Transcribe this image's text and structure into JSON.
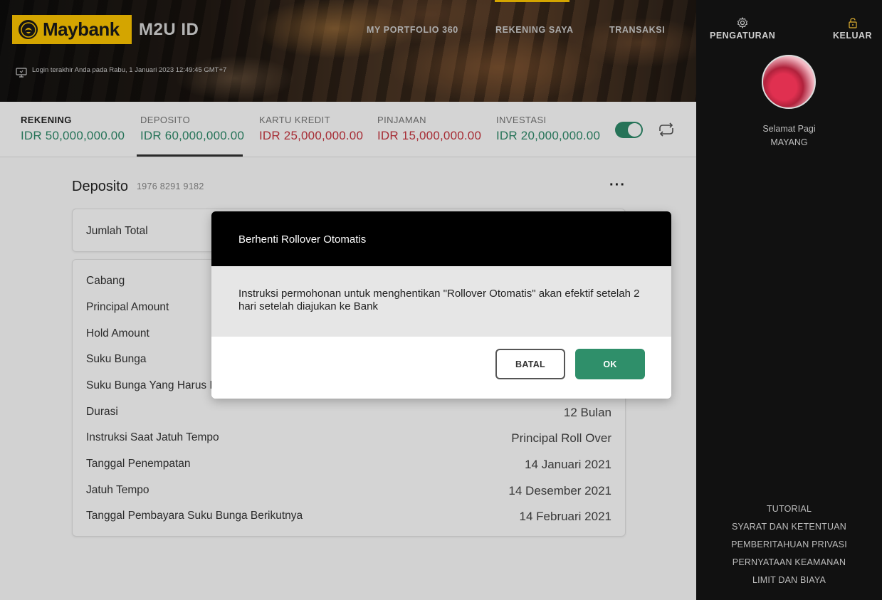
{
  "brand": {
    "logo_text": "Maybank",
    "app_title": "M2U ID"
  },
  "header": {
    "last_login": "Login terakhir Anda pada Rabu, 1 Januari 2023 12:49:45 GMT+7",
    "nav": [
      "MY PORTFOLIO 360",
      "REKENING SAYA",
      "TRANSAKSI"
    ]
  },
  "side": {
    "settings_label": "PENGATURAN",
    "logout_label": "KELUAR",
    "greeting": "Selamat Pagi",
    "user_name": "MAYANG",
    "links": [
      "TUTORIAL",
      "SYARAT DAN KETENTUAN",
      "PEMBERITAHUAN PRIVASI",
      "PERNYATAAN KEAMANAN",
      "LIMIT DAN BIAYA"
    ]
  },
  "summary": [
    {
      "label": "REKENING",
      "value": "IDR 50,000,000.00",
      "color": "#2e8b6a"
    },
    {
      "label": "DEPOSITO",
      "value": "IDR 60,000,000.00",
      "color": "#2e8b6a"
    },
    {
      "label": "KARTU KREDIT",
      "value": "IDR 25,000,000.00",
      "color": "#c8353f"
    },
    {
      "label": "PINJAMAN",
      "value": "IDR 15,000,000.00",
      "color": "#c8353f"
    },
    {
      "label": "INVESTASI",
      "value": "IDR 20,000,000.00",
      "color": "#2e8b6a"
    }
  ],
  "deposit": {
    "title": "Deposito",
    "account_number": "1976 8291 9182",
    "total_label": "Jumlah Total",
    "rows": [
      {
        "label": "Cabang",
        "value": ""
      },
      {
        "label": "Principal Amount",
        "value": ""
      },
      {
        "label": "Hold Amount",
        "value": ""
      },
      {
        "label": "Suku Bunga",
        "value": ""
      },
      {
        "label": "Suku Bunga Yang Harus Dibayar",
        "value": ""
      },
      {
        "label": "Durasi",
        "value": "12 Bulan"
      },
      {
        "label": "Instruksi Saat Jatuh Tempo",
        "value": "Principal Roll Over"
      },
      {
        "label": "Tanggal Penempatan",
        "value": "14 Januari 2021"
      },
      {
        "label": "Jatuh Tempo",
        "value": "14 Desember 2021"
      },
      {
        "label": "Tanggal Pembayara Suku Bunga Berikutnya",
        "value": "14 Februari 2021"
      }
    ]
  },
  "modal": {
    "title": "Berhenti Rollover Otomatis",
    "message": "Instruksi permohonan untuk menghentikan \"Rollover Otomatis\" akan efektif setelah 2 hari setelah diajukan ke Bank",
    "cancel_label": "BATAL",
    "ok_label": "OK"
  },
  "colors": {
    "accent_green": "#2e8b6a",
    "negative_red": "#c8353f",
    "brand_yellow": "#ffc700"
  }
}
